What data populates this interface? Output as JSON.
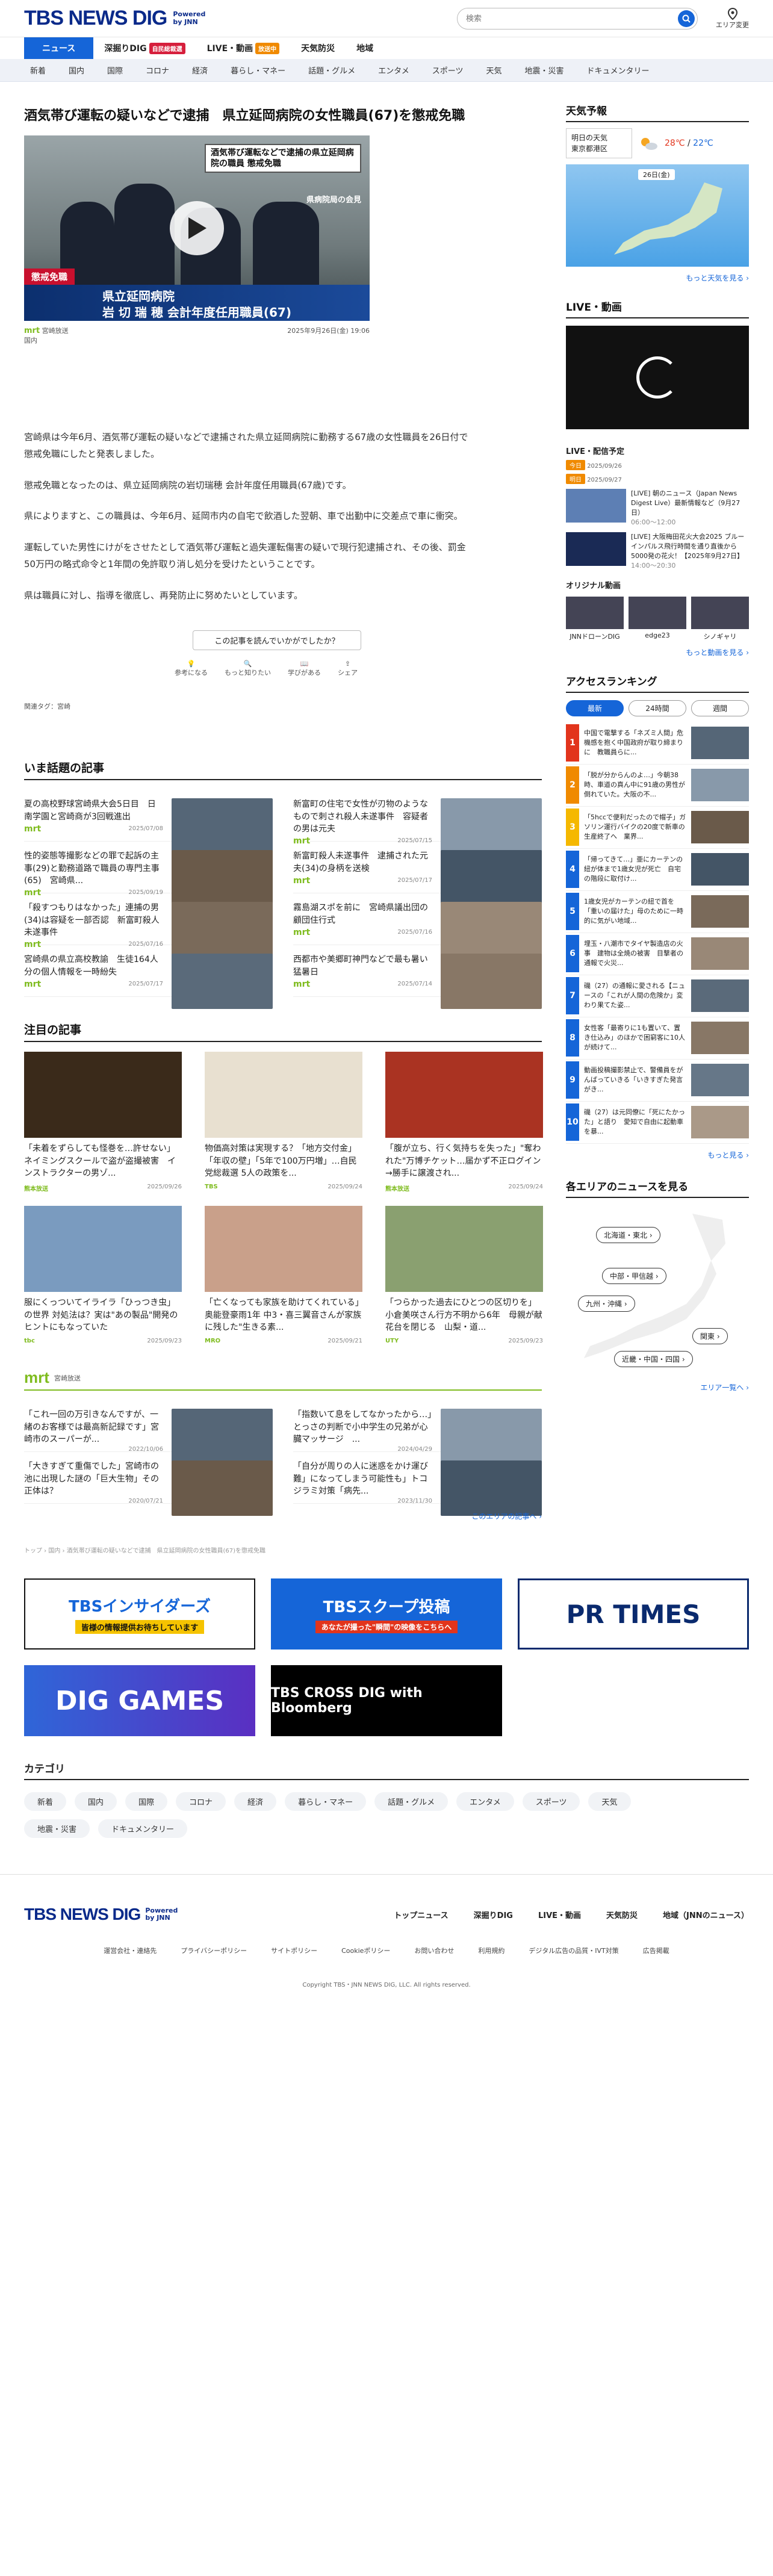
{
  "header": {
    "logo": "TBS NEWS DIG",
    "powered": "Powered by JNN",
    "search_placeholder": "検索",
    "area_label": "エリア変更"
  },
  "nav1": [
    {
      "label": "ニュース",
      "active": true
    },
    {
      "label": "深掘りDIG",
      "badge": "自民総裁選",
      "badge_color": "#d61f3c"
    },
    {
      "label": "LIVE・動画",
      "badge": "放送中",
      "badge_color": "#f08a00"
    },
    {
      "label": "天気防災"
    },
    {
      "label": "地域"
    }
  ],
  "nav2": [
    "新着",
    "国内",
    "国際",
    "コロナ",
    "経済",
    "暮らし・マネー",
    "話題・グルメ",
    "エンタメ",
    "スポーツ",
    "天気",
    "地震・災害",
    "ドキュメンタリー"
  ],
  "article": {
    "title": "酒気帯び運転の疑いなどで逮捕　県立延岡病院の女性職員(67)を懲戒免職",
    "hero": {
      "caption1": "酒気帯び運転などで逮捕の県立延岡病院の職員 懲戒免職",
      "caption2": "県病院局の会見",
      "label": "懲戒免職",
      "lower1": "県立延岡病院",
      "lower2": "岩 切 瑞 穂  会計年度任用職員(67)"
    },
    "source": "宮崎放送",
    "source_logo": "mrt",
    "datetime": "2025年9月26日(金) 19:06",
    "category": "国内",
    "body": [
      "宮崎県は今年6月、酒気帯び運転の疑いなどで逮捕された県立延岡病院に勤務する67歳の女性職員を26日付で懲戒免職にしたと発表しました。",
      "懲戒免職となったのは、県立延岡病院の岩切瑞穂 会計年度任用職員(67歳)です。",
      "県によりますと、この職員は、今年6月、延岡市内の自宅で飲酒した翌朝、車で出勤中に交差点で車に衝突。",
      "運転していた男性にけがをさせたとして酒気帯び運転と過失運転傷害の疑いで現行犯逮捕され、その後、罰金50万円の略式命令と1年間の免許取り消し処分を受けたということです。",
      "県は職員に対し、指導を徹底し、再発防止に努めたいとしています。"
    ],
    "feedback_q": "この記事を読んでいかがでしたか？",
    "feedback": [
      "参考になる",
      "もっと知りたい",
      "学びがある",
      "シェア"
    ],
    "tags": "関連タグ：宮崎"
  },
  "trending": {
    "title": "いま話題の記事",
    "items": [
      {
        "text": "夏の高校野球宮崎県大会5日目　日南学園と宮崎商が3回戦進出",
        "date": "2025/07/08",
        "src": "mrt"
      },
      {
        "text": "新富町の住宅で女性が刃物のようなもので刺され殺人未遂事件　容疑者の男は元夫",
        "date": "2025/07/15",
        "src": "mrt"
      },
      {
        "text": "性的姿態等撮影などの罪で起訴の主事(29)と勤務道路で職員の専門主事(65)　宮崎県...",
        "date": "2025/09/19",
        "src": "mrt"
      },
      {
        "text": "新富町殺人未遂事件　逮捕された元夫(34)の身柄を送検",
        "date": "2025/07/17",
        "src": "mrt"
      },
      {
        "text": "「殺すつもりはなかった」連捕の男(34)は容疑を一部否認　新富町殺人未遂事件",
        "date": "2025/07/16",
        "src": "mrt"
      },
      {
        "text": "霧島湖スポを前に　宮崎県議出団の顧団住行式",
        "date": "2025/07/16",
        "src": "mrt"
      },
      {
        "text": "宮崎県の県立高校教諭　生徒164人分の個人情報を一時紛失",
        "date": "2025/07/17",
        "src": "mrt"
      },
      {
        "text": "西都市や美郷町神門などで最も暑い猛暑日",
        "date": "2025/07/14",
        "src": "mrt"
      }
    ]
  },
  "featured": {
    "title": "注目の記事",
    "items": [
      {
        "text": "「未着をずらしても怪巻を…許せない」ネイミングスクールで盗が盗撮被害　インストラクターの男ゾ...",
        "date": "2025/09/26",
        "src": "熊本放送"
      },
      {
        "text": "物価高対策は実現する？「地方交付金」「年収の壁」「5年で100万円増」…自民党総裁選 5人の政策を...",
        "date": "2025/09/24",
        "src": "TBS"
      },
      {
        "text": "「腹が立ち、行く気持ちを失った」\"奪われた\"万博チケット…届かず不正ログイン→勝手に譲渡され...",
        "date": "2025/09/24",
        "src": "熊本放送"
      },
      {
        "text": "服にくっついてイライラ「ひっつき虫」の世界 対処法は？実は\"あの製品\"開発のヒントにもなっていた",
        "date": "2025/09/23",
        "src": "tbc"
      },
      {
        "text": "「亡くなっても家族を助けてくれている」奥能登豪雨1年 中3・喜三翼音さんが家族に残した\"生きる素...",
        "date": "2025/09/21",
        "src": "MRO"
      },
      {
        "text": "「つらかった過去にひとつの区切りを」小倉美咲さん行方不明から6年　母親が献花台を閉じる　山梨・道...",
        "date": "2025/09/23",
        "src": "UTY"
      }
    ]
  },
  "mrt_section": {
    "logo": "mrt",
    "name": "宮崎放送",
    "items": [
      {
        "text": "「これ一回の万引きなんですが、一緒のお客様では最高新記録です」宮崎市のスーパーが...",
        "date": "2022/10/06"
      },
      {
        "text": "「指数いて息をしてなかったから…」とっさの判断で小中学生の兄弟が心臓マッサージ　...",
        "date": "2024/04/29"
      },
      {
        "text": "「大きすぎて重傷でした」宮崎市の池に出現した謎の「巨大生物」その正体は？",
        "date": "2020/07/21"
      },
      {
        "text": "「自分が周りの人に迷惑をかけ運び難」になってしまう可能性も」トコジラミ対策「病先...",
        "date": "2023/11/30"
      }
    ],
    "more": "このエリアの記事へ ›"
  },
  "breadcrumb": "トップ › 国内 › 酒気帯び運転の疑いなどで逮捕　県立延岡病院の女性職員(67)を懲戒免職",
  "banners": [
    "TBSインサイダーズ",
    "TBSスクープ投稿",
    "PR TIMES",
    "DIG GAMES",
    "TBS CROSS DIG with Bloomberg"
  ],
  "banner_sub": "皆様の情報提供お待ちしています",
  "banner_sub2": "あなたが撮った\"瞬間\"の映像をこちらへ",
  "categories": {
    "title": "カテゴリ",
    "items": [
      "新着",
      "国内",
      "国際",
      "コロナ",
      "経済",
      "暮らし・マネー",
      "話題・グルメ",
      "エンタメ",
      "スポーツ",
      "天気",
      "地震・災害",
      "ドキュメンタリー"
    ]
  },
  "footer": {
    "links": [
      "トップニュース",
      "深掘りDIG",
      "LIVE・動画",
      "天気防災",
      "地域（JNNのニュース）"
    ],
    "sub": [
      "運営会社・連絡先",
      "プライバシーポリシー",
      "サイトポリシー",
      "Cookieポリシー",
      "お問い合わせ",
      "利用規約",
      "デジタル広告の品質・IVT対策",
      "広告掲載"
    ],
    "copyright": "Copyright TBS・JNN NEWS DIG, LLC. All rights reserved."
  },
  "sidebar": {
    "weather_title": "天気予報",
    "weather_day": "明日の天気",
    "weather_area": "東京都港区",
    "temp_hi": "28℃",
    "temp_lo": "22℃",
    "weather_date": "26日(金)",
    "weather_more": "もっと天気を見る ›",
    "live_title": "LIVE・動画",
    "sched_title": "LIVE・配信予定",
    "sched": [
      {
        "tag": "今日",
        "date": "2025/09/26"
      },
      {
        "tag": "明日",
        "date": "2025/09/27",
        "title": "[LIVE] 朝のニュース（Japan News Digest Live）最新情報など（9月27日）",
        "time": "06:00～12:00"
      },
      {
        "title": "[LIVE] 大阪梅田花火大会2025 ブルーインパルス飛行時間を通り直後から5000発の花火！【2025年9月27日】",
        "time": "14:00～20:30"
      }
    ],
    "orig_title": "オリジナル動画",
    "orig": [
      "JNNドローンDIG",
      "edge23",
      "シノギャリ"
    ],
    "orig_more": "もっと動画を見る ›",
    "rank_title": "アクセスランキング",
    "rank_tabs": [
      "最新",
      "24時間",
      "週間"
    ],
    "rank": [
      "中国で電撃する「ネズミ人間」危機感を抱く中国政府が取り締まりに　教職員らに...",
      "「脱が分からんのよ…」今朝38時、車道の真ん中に91歳の男性が倒れていた。大阪の不...",
      "「5hccで便利だったので帽子」ガソリン運行バイクの20度で新車の生産終了へ　業界...",
      "「帰ってきて…」亜にカーテンの紐が体まで1歳女児が死亡　自宅の階段に取付け...",
      "1歳女児がカーテンの紐で首を「重いの届けた」母のために一時的に気がい地域...",
      "埋玉・八潮市でタイヤ製造店の火事　建物は全焼の被害　目撃者の通報で火災...",
      "磯（27）の通報に愛される【ニュースの「これが人間の危険か」変わり果てた姿...",
      "女性客「最寄りに1も置いて、置き仕込み」のほかで困窮客に10人が続けて...",
      "動画投稿撮影禁止で、警備員をがんばっていきる「いきすぎた発言がき...",
      "磯（27）は元同僚に「死にたかった」と語り　愛知で自由に起動車を暴..."
    ],
    "rank_more": "もっと見る ›",
    "area_title": "各エリアのニュースを見る",
    "areas": [
      "北海道・東北 ›",
      "中部・甲信越 ›",
      "九州・沖縄 ›",
      "関東 ›",
      "近畿・中国・四国 ›"
    ],
    "area_more": "エリア一覧へ ›"
  }
}
